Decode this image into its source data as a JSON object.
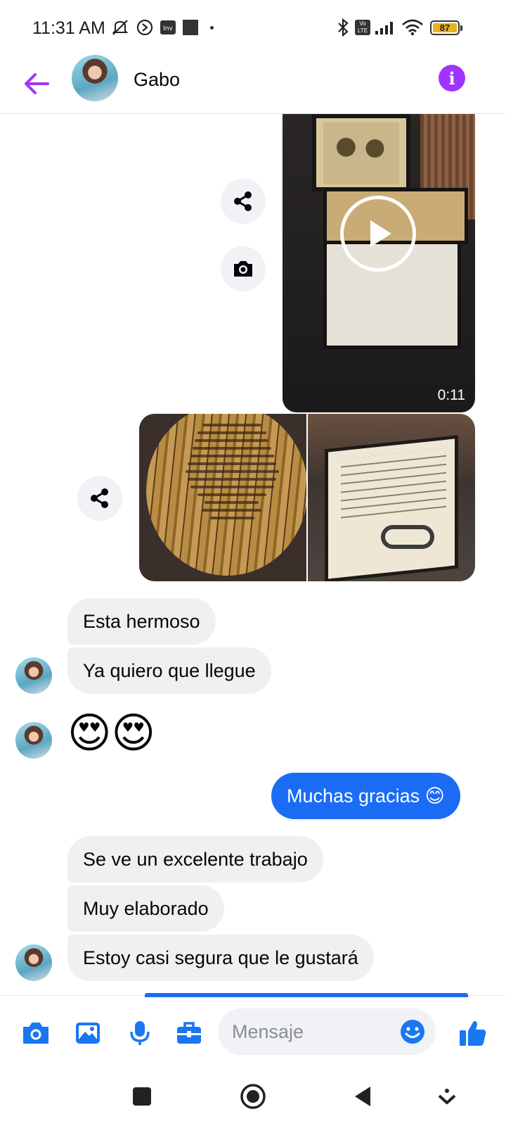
{
  "status_bar": {
    "time": "11:31 AM",
    "network_badge": "Vo LTE",
    "battery": "87",
    "icons": [
      "mute-icon",
      "nfc-icon",
      "inv-app-icon",
      "square-icon",
      "dot-icon",
      "bluetooth-icon",
      "signal-icon",
      "wifi-icon",
      "battery-icon"
    ],
    "battery_color": "#e8b21a"
  },
  "header": {
    "contact_name": "Gabo",
    "back_icon": "back-arrow-icon",
    "info_icon": "info-icon",
    "accent_color": "#a033ff"
  },
  "media": {
    "video_duration": "0:11"
  },
  "messages": {
    "received_1": "Esta hermoso",
    "received_2": "Ya quiero que llegue",
    "received_emojis": "😍😍",
    "sent_1": "Muchas gracias 😊",
    "received_3": "Se ve un excelente trabajo",
    "received_4": "Muy elaborado",
    "received_5": "Estoy casi segura que le gustará"
  },
  "composer": {
    "placeholder": "Mensaje",
    "tool_color": "#1877f2",
    "tools": [
      "camera-icon",
      "gallery-icon",
      "microphone-icon",
      "toolbox-icon"
    ],
    "emoji_icon": "emoji-icon",
    "like_icon": "thumbs-up-icon"
  },
  "colors": {
    "sent_bubble": "#1a6cf5",
    "received_bubble": "#f0f0f0"
  }
}
